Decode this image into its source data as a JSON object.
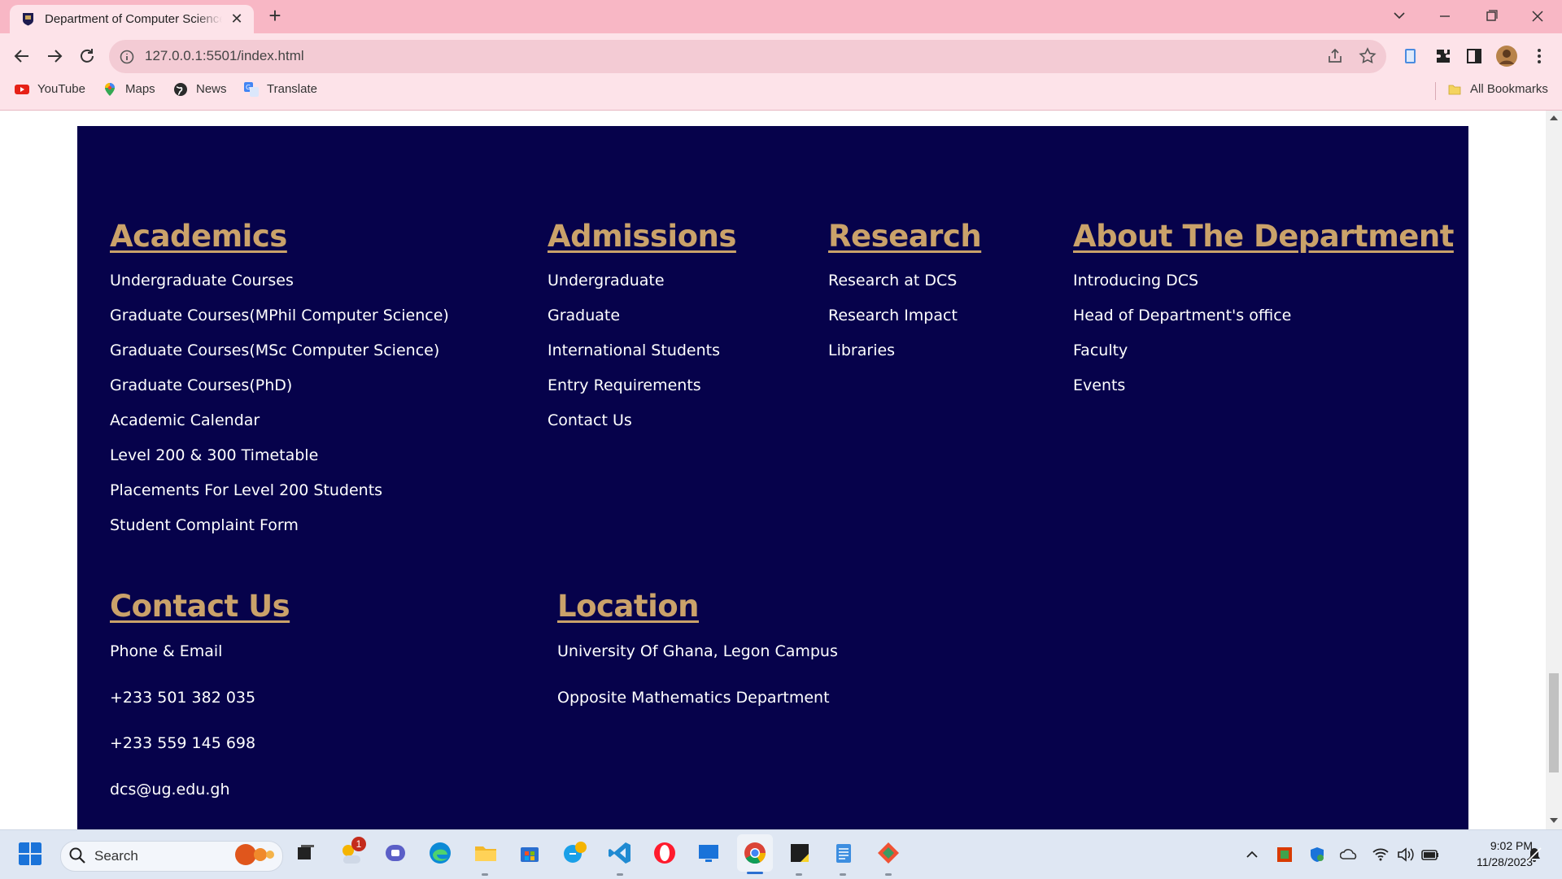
{
  "browser": {
    "tab_title": "Department of Computer Science",
    "url": "127.0.0.1:5501/index.html",
    "bookmarks": [
      "YouTube",
      "Maps",
      "News",
      "Translate"
    ],
    "all_bookmarks": "All Bookmarks"
  },
  "footer": {
    "sections": [
      {
        "heading": "Academics",
        "links": [
          "Undergraduate Courses",
          "Graduate Courses(MPhil Computer Science)",
          "Graduate Courses(MSc Computer Science)",
          "Graduate Courses(PhD)",
          "Academic Calendar",
          "Level 200 & 300 Timetable",
          "Placements For Level 200 Students",
          "Student Complaint Form"
        ]
      },
      {
        "heading": "Admissions",
        "links": [
          "Undergraduate",
          "Graduate",
          "International Students",
          "Entry Requirements",
          "Contact Us"
        ]
      },
      {
        "heading": "Research",
        "links": [
          "Research at DCS",
          "Research Impact",
          "Libraries"
        ]
      },
      {
        "heading": "About The Department",
        "links": [
          "Introducing DCS",
          "Head of Department's office",
          "Faculty",
          "Events"
        ]
      }
    ],
    "contact": {
      "heading": "Contact Us",
      "items": [
        "Phone & Email",
        "+233 501 382 035",
        "+233 559 145 698",
        "dcs@ug.edu.gh"
      ]
    },
    "location": {
      "heading": "Location",
      "items": [
        "University Of Ghana, Legon Campus",
        "Opposite Mathematics Department"
      ]
    }
  },
  "taskbar": {
    "search_label": "Search",
    "notification_badge": "1",
    "time": "9:02 PM",
    "date": "11/28/2023"
  },
  "colors": {
    "footer_bg": "#06024b",
    "heading": "#caa26a",
    "link": "#ffffff",
    "chrome_frame": "#f8b7c5"
  }
}
